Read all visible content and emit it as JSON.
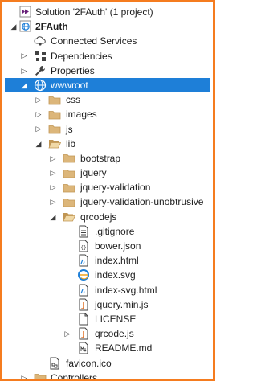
{
  "tree": [
    {
      "label": "Solution '2FAuth' (1 project)",
      "icon": "solution-icon",
      "toggle": "none",
      "depth": 0,
      "selected": false,
      "bold": false
    },
    {
      "label": "2FAuth",
      "icon": "web-project-icon",
      "toggle": "expanded",
      "depth": 0,
      "selected": false,
      "bold": true
    },
    {
      "label": "Connected Services",
      "icon": "connected-services-icon",
      "toggle": "none",
      "depth": 1,
      "selected": false,
      "bold": false
    },
    {
      "label": "Dependencies",
      "icon": "dependencies-icon",
      "toggle": "collapsed",
      "depth": 1,
      "selected": false,
      "bold": false
    },
    {
      "label": "Properties",
      "icon": "wrench-icon",
      "toggle": "collapsed",
      "depth": 1,
      "selected": false,
      "bold": false
    },
    {
      "label": "wwwroot",
      "icon": "globe-icon",
      "toggle": "expanded",
      "depth": 1,
      "selected": true,
      "bold": false
    },
    {
      "label": "css",
      "icon": "folder-icon",
      "toggle": "collapsed",
      "depth": 2,
      "selected": false,
      "bold": false
    },
    {
      "label": "images",
      "icon": "folder-icon",
      "toggle": "collapsed",
      "depth": 2,
      "selected": false,
      "bold": false
    },
    {
      "label": "js",
      "icon": "folder-icon",
      "toggle": "collapsed",
      "depth": 2,
      "selected": false,
      "bold": false
    },
    {
      "label": "lib",
      "icon": "folder-open-icon",
      "toggle": "expanded",
      "depth": 2,
      "selected": false,
      "bold": false
    },
    {
      "label": "bootstrap",
      "icon": "folder-icon",
      "toggle": "collapsed",
      "depth": 3,
      "selected": false,
      "bold": false
    },
    {
      "label": "jquery",
      "icon": "folder-icon",
      "toggle": "collapsed",
      "depth": 3,
      "selected": false,
      "bold": false
    },
    {
      "label": "jquery-validation",
      "icon": "folder-icon",
      "toggle": "collapsed",
      "depth": 3,
      "selected": false,
      "bold": false
    },
    {
      "label": "jquery-validation-unobtrusive",
      "icon": "folder-icon",
      "toggle": "collapsed",
      "depth": 3,
      "selected": false,
      "bold": false
    },
    {
      "label": "qrcodejs",
      "icon": "folder-open-icon",
      "toggle": "expanded",
      "depth": 3,
      "selected": false,
      "bold": false
    },
    {
      "label": ".gitignore",
      "icon": "text-file-icon",
      "toggle": "none",
      "depth": 4,
      "selected": false,
      "bold": false
    },
    {
      "label": "bower.json",
      "icon": "json-file-icon",
      "toggle": "none",
      "depth": 4,
      "selected": false,
      "bold": false
    },
    {
      "label": "index.html",
      "icon": "html-file-icon",
      "toggle": "none",
      "depth": 4,
      "selected": false,
      "bold": false
    },
    {
      "label": "index.svg",
      "icon": "svg-browser-icon",
      "toggle": "none",
      "depth": 4,
      "selected": false,
      "bold": false
    },
    {
      "label": "index-svg.html",
      "icon": "html-file-icon",
      "toggle": "none",
      "depth": 4,
      "selected": false,
      "bold": false
    },
    {
      "label": "jquery.min.js",
      "icon": "js-file-icon",
      "toggle": "none",
      "depth": 4,
      "selected": false,
      "bold": false
    },
    {
      "label": "LICENSE",
      "icon": "blank-file-icon",
      "toggle": "none",
      "depth": 4,
      "selected": false,
      "bold": false
    },
    {
      "label": "qrcode.js",
      "icon": "js-file-icon",
      "toggle": "collapsed",
      "depth": 4,
      "selected": false,
      "bold": false
    },
    {
      "label": "README.md",
      "icon": "markdown-file-icon",
      "toggle": "none",
      "depth": 4,
      "selected": false,
      "bold": false
    },
    {
      "label": "favicon.ico",
      "icon": "ico-file-icon",
      "toggle": "none",
      "depth": 2,
      "selected": false,
      "bold": false
    },
    {
      "label": "Controllers",
      "icon": "folder-icon",
      "toggle": "collapsed",
      "depth": 1,
      "selected": false,
      "bold": false
    }
  ],
  "colors": {
    "frame_border": "#f57c1f",
    "selection": "#1e7fd8",
    "folder": "#dcb67a"
  }
}
